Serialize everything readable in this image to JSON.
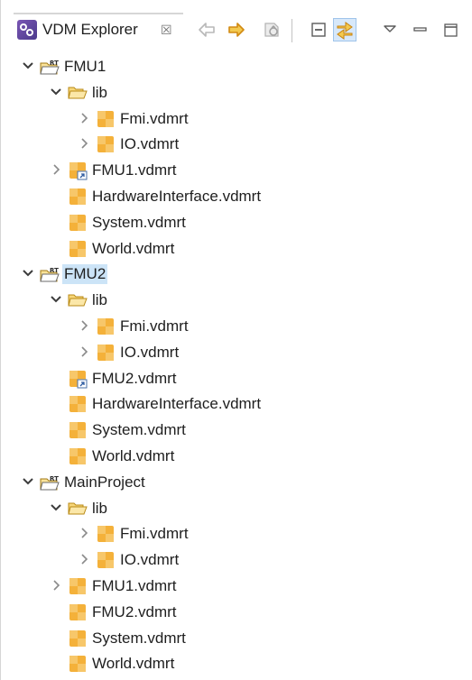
{
  "view": {
    "title": "VDM Explorer",
    "close_glyph": "☒",
    "icon": "vdm-explorer-icon"
  },
  "toolbar": {
    "buttons": [
      {
        "name": "back-button",
        "icon": "arrow-left-icon"
      },
      {
        "name": "forward-button",
        "icon": "arrow-right-icon"
      },
      {
        "name": "up-button",
        "icon": "go-up-icon"
      },
      {
        "name": "collapse-all-button",
        "icon": "collapse-all-icon"
      },
      {
        "name": "link-with-editor-button",
        "icon": "link-with-editor-icon",
        "active": true
      },
      {
        "name": "view-menu-button",
        "icon": "view-menu-icon"
      },
      {
        "name": "minimize-button",
        "icon": "minimize-icon"
      },
      {
        "name": "maximize-button",
        "icon": "maximize-icon"
      }
    ]
  },
  "tree": [
    {
      "label": "FMU1",
      "type": "project",
      "level": 0,
      "twisty": "open"
    },
    {
      "label": "lib",
      "type": "folder",
      "level": 1,
      "twisty": "open"
    },
    {
      "label": "Fmi.vdmrt",
      "type": "file",
      "level": 2,
      "twisty": "closed"
    },
    {
      "label": "IO.vdmrt",
      "type": "file",
      "level": 2,
      "twisty": "closed"
    },
    {
      "label": "FMU1.vdmrt",
      "type": "file-link",
      "level": 1,
      "twisty": "closed"
    },
    {
      "label": "HardwareInterface.vdmrt",
      "type": "file",
      "level": 1,
      "twisty": "none"
    },
    {
      "label": "System.vdmrt",
      "type": "file",
      "level": 1,
      "twisty": "none"
    },
    {
      "label": "World.vdmrt",
      "type": "file",
      "level": 1,
      "twisty": "none"
    },
    {
      "label": "FMU2",
      "type": "project",
      "level": 0,
      "twisty": "open",
      "selected": true
    },
    {
      "label": "lib",
      "type": "folder",
      "level": 1,
      "twisty": "open"
    },
    {
      "label": "Fmi.vdmrt",
      "type": "file",
      "level": 2,
      "twisty": "closed"
    },
    {
      "label": "IO.vdmrt",
      "type": "file",
      "level": 2,
      "twisty": "closed"
    },
    {
      "label": "FMU2.vdmrt",
      "type": "file-link",
      "level": 1,
      "twisty": "none"
    },
    {
      "label": "HardwareInterface.vdmrt",
      "type": "file",
      "level": 1,
      "twisty": "none"
    },
    {
      "label": "System.vdmrt",
      "type": "file",
      "level": 1,
      "twisty": "none"
    },
    {
      "label": "World.vdmrt",
      "type": "file",
      "level": 1,
      "twisty": "none"
    },
    {
      "label": "MainProject",
      "type": "project",
      "level": 0,
      "twisty": "open"
    },
    {
      "label": "lib",
      "type": "folder",
      "level": 1,
      "twisty": "open"
    },
    {
      "label": "Fmi.vdmrt",
      "type": "file",
      "level": 2,
      "twisty": "closed"
    },
    {
      "label": "IO.vdmrt",
      "type": "file",
      "level": 2,
      "twisty": "closed"
    },
    {
      "label": "FMU1.vdmrt",
      "type": "file",
      "level": 1,
      "twisty": "closed"
    },
    {
      "label": "FMU2.vdmrt",
      "type": "file",
      "level": 1,
      "twisty": "none"
    },
    {
      "label": "System.vdmrt",
      "type": "file",
      "level": 1,
      "twisty": "none"
    },
    {
      "label": "World.vdmrt",
      "type": "file",
      "level": 1,
      "twisty": "none"
    }
  ],
  "colors": {
    "selection": "#cce4f7",
    "folder": "#f3c94f",
    "file": "#f0b238",
    "twisty": "#505050",
    "active_toolbar": "#d7e8fa"
  }
}
